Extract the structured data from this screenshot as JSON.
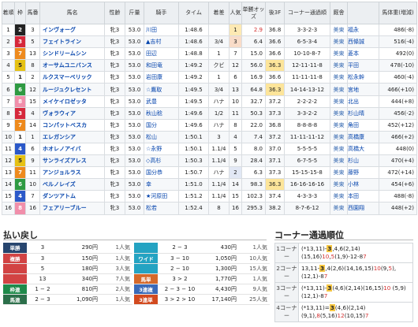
{
  "headers": {
    "rank": "着順",
    "waku": "枠",
    "num": "馬番",
    "name": "馬名",
    "sex_age": "性齢",
    "weight": "斤量",
    "jockey": "騎手",
    "time": "タイム",
    "margin": "着差",
    "pop": "人気",
    "odds": "単勝オッズ",
    "last3f": "後3F",
    "corner": "コーナー通過順",
    "aff": "厩舎",
    "body": "馬体重(増減)"
  },
  "horses": [
    {
      "rank": "1",
      "waku": "2",
      "num": "3",
      "name": "インヴォーグ",
      "sex_age": "牝3",
      "weight": "53.0",
      "jockey": "川田",
      "time": "1:48.6",
      "margin": "",
      "pop": "1",
      "odds": "2.9",
      "last3f": "36.8",
      "corner": "3-3-2-3",
      "aff": "美東",
      "trainer": "福永",
      "body": "486(-8)"
    },
    {
      "rank": "2",
      "waku": "3",
      "num": "5",
      "name": "フェイトライン",
      "sex_age": "牝3",
      "weight": "53.0",
      "jockey": "▲吉村",
      "time": "1:48.6",
      "margin": "3/4",
      "pop": "3",
      "odds": "6.4",
      "last3f": "36.6",
      "corner": "6-5-3-4",
      "aff": "美東",
      "trainer": "西條誠",
      "body": "516(-4)"
    },
    {
      "rank": "3",
      "waku": "7",
      "num": "13",
      "name": "シンドリームシン",
      "sex_age": "牝3",
      "weight": "53.0",
      "jockey": "田辺",
      "time": "1:48.8",
      "margin": "1",
      "pop": "7",
      "odds": "15.0",
      "last3f": "36.6",
      "corner": "10-10-8-7",
      "aff": "美東",
      "trainer": "菱本",
      "body": "492(0)"
    },
    {
      "rank": "4",
      "waku": "5",
      "num": "8",
      "name": "オーサムユニバンス",
      "sex_age": "牝3",
      "weight": "53.0",
      "jockey": "和田竜",
      "time": "1:49.2",
      "margin": "クビ",
      "pop": "12",
      "odds": "56.0",
      "last3f": "36.3",
      "corner": "12-11-11-8",
      "aff": "美東",
      "trainer": "平田",
      "body": "478(-10)"
    },
    {
      "rank": "5",
      "waku": "1",
      "num": "2",
      "name": "ルクスマーベリック",
      "sex_age": "牝3",
      "weight": "53.0",
      "jockey": "岩田康",
      "time": "1:49.2",
      "margin": "1",
      "pop": "6",
      "odds": "16.9",
      "last3f": "36.6",
      "corner": "11-11-11-8",
      "aff": "美東",
      "trainer": "松永幹",
      "body": "460(-4)"
    },
    {
      "rank": "6",
      "waku": "6",
      "num": "12",
      "name": "ルージュクレセント",
      "sex_age": "牝3",
      "weight": "53.0",
      "jockey": "☆鷹取",
      "time": "1:49.5",
      "margin": "3/4",
      "pop": "13",
      "odds": "64.8",
      "last3f": "36.3",
      "corner": "14-14-13-12",
      "aff": "美東",
      "trainer": "宮地",
      "body": "466(+10)"
    },
    {
      "rank": "7",
      "waku": "8",
      "num": "15",
      "name": "メイケイロゼッタ",
      "sex_age": "牝3",
      "weight": "53.0",
      "jockey": "武豊",
      "time": "1:49.5",
      "margin": "ハナ",
      "pop": "10",
      "odds": "32.7",
      "last3f": "37.2",
      "corner": "2-2-2-2",
      "aff": "美東",
      "trainer": "北出",
      "body": "444(+8)"
    },
    {
      "rank": "8",
      "waku": "3",
      "num": "4",
      "name": "ヴォラウィア",
      "sex_age": "牝3",
      "weight": "53.0",
      "jockey": "秋山稔",
      "time": "1:49.6",
      "margin": "1/2",
      "pop": "11",
      "odds": "50.3",
      "last3f": "37.3",
      "corner": "3-3-2-2",
      "aff": "美東",
      "trainer": "杉山晴",
      "body": "456(-2)"
    },
    {
      "rank": "9",
      "waku": "7",
      "num": "14",
      "name": "コンパットベスカ",
      "sex_age": "牝3",
      "weight": "53.0",
      "jockey": "国分",
      "time": "1:49.6",
      "margin": "ハナ",
      "pop": "8",
      "odds": "22.0",
      "last3f": "36.8",
      "corner": "8-8-8-8",
      "aff": "美東",
      "trainer": "角田",
      "body": "452(+12)"
    },
    {
      "rank": "10",
      "waku": "1",
      "num": "1",
      "name": "エレガンシア",
      "sex_age": "牝3",
      "weight": "53.0",
      "jockey": "松山",
      "time": "1:50.1",
      "margin": "3",
      "pop": "4",
      "odds": "7.4",
      "last3f": "37.2",
      "corner": "11-11-11-12",
      "aff": "美東",
      "trainer": "高橋康",
      "body": "466(+2)"
    },
    {
      "rank": "11",
      "waku": "4",
      "num": "6",
      "name": "ホオレノアイバ",
      "sex_age": "牝3",
      "weight": "53.0",
      "jockey": "☆永野",
      "time": "1:50.1",
      "margin": "1.1/4",
      "pop": "5",
      "odds": "8.0",
      "last3f": "37.0",
      "corner": "5-5-5-5",
      "aff": "美東",
      "trainer": "高橋大",
      "body": "448(0)"
    },
    {
      "rank": "12",
      "waku": "5",
      "num": "9",
      "name": "サンライズアレス",
      "sex_age": "牝3",
      "weight": "53.0",
      "jockey": "◇高杉",
      "time": "1:50.3",
      "margin": "1.1/4",
      "pop": "9",
      "odds": "28.4",
      "last3f": "37.1",
      "corner": "6-7-5-5",
      "aff": "美東",
      "trainer": "杉山",
      "body": "470(+4)"
    },
    {
      "rank": "13",
      "waku": "7",
      "num": "11",
      "name": "アンジョルラス",
      "sex_age": "牝3",
      "weight": "53.0",
      "jockey": "国分恭",
      "time": "1:50.7",
      "margin": "ハナ",
      "pop": "2",
      "odds": "6.3",
      "last3f": "37.3",
      "corner": "15-15-15-8",
      "aff": "美東",
      "trainer": "藤野",
      "body": "472(+14)"
    },
    {
      "rank": "14",
      "waku": "6",
      "num": "10",
      "name": "ベルノレイズ",
      "sex_age": "牝3",
      "weight": "53.0",
      "jockey": "幸",
      "time": "1:51.0",
      "margin": "1.1/4",
      "pop": "14",
      "odds": "98.3",
      "last3f": "36.3",
      "corner": "16-16-16-16",
      "aff": "美東",
      "trainer": "小林",
      "body": "454(+6)"
    },
    {
      "rank": "15",
      "waku": "4",
      "num": "7",
      "name": "ダンツアトム",
      "sex_age": "牝3",
      "weight": "53.0",
      "jockey": "★河原田",
      "time": "1:51.2",
      "margin": "1.1/4",
      "pop": "15",
      "odds": "102.3",
      "last3f": "37.4",
      "corner": "4-3-3-3",
      "aff": "美東",
      "trainer": "本田",
      "body": "488(-8)"
    },
    {
      "rank": "16",
      "waku": "8",
      "num": "16",
      "name": "フェアリーブルー",
      "sex_age": "牝3",
      "weight": "53.0",
      "jockey": "松若",
      "time": "1:52.4",
      "margin": "8",
      "pop": "16",
      "odds": "295.3",
      "last3f": "38.2",
      "corner": "8-7-6-12",
      "aff": "美東",
      "trainer": "西園翔",
      "body": "448(+2)"
    }
  ],
  "payout": {
    "title": "払い戻し",
    "left": [
      {
        "type": "単勝",
        "num": "3",
        "amt": "290円",
        "pop": "1人気",
        "cls": "bt-tan"
      },
      {
        "type": "複勝",
        "num": "3",
        "amt": "150円",
        "pop": "1人気",
        "cls": "bt-fuku"
      },
      {
        "type": "",
        "num": "5",
        "amt": "180円",
        "pop": "3人気",
        "cls": "bt-fuku"
      },
      {
        "type": "",
        "num": "13",
        "amt": "340円",
        "pop": "7人気",
        "cls": "bt-fuku"
      },
      {
        "type": "枠連",
        "num": "1 − 2",
        "amt": "810円",
        "pop": "2人気",
        "cls": "bt-waku"
      },
      {
        "type": "馬連",
        "num": "2 − 3",
        "amt": "1,090円",
        "pop": "1人気",
        "cls": "bt-uren"
      }
    ],
    "right": [
      {
        "type": "",
        "num": "2 − 3",
        "amt": "430円",
        "pop": "1人気",
        "cls": "bt-wide"
      },
      {
        "type": "ワイド",
        "num": "3 − 10",
        "amt": "1,050円",
        "pop": "10人気",
        "cls": "bt-wide"
      },
      {
        "type": "",
        "num": "2 − 10",
        "amt": "1,300円",
        "pop": "15人気",
        "cls": "bt-wide"
      },
      {
        "type": "馬単",
        "num": "3 > 2",
        "amt": "1,770円",
        "pop": "1人気",
        "cls": "bt-uta"
      },
      {
        "type": "3連複",
        "num": "2 − 3 − 10",
        "amt": "4,430円",
        "pop": "9人気",
        "cls": "bt-3fuku"
      },
      {
        "type": "3連単",
        "num": "3 > 2 > 10",
        "amt": "17,140円",
        "pop": "25人気",
        "cls": "bt-3tan"
      }
    ]
  },
  "corner": {
    "title": "コーナー通過順位",
    "rows": [
      {
        "label": "1コーナー",
        "parts": [
          [
            "(*13,11)-",
            ""
          ],
          [
            "3",
            "hl"
          ],
          [
            ",4,6(2,14)(15,16)",
            ""
          ],
          [
            "10",
            "red"
          ],
          [
            ",",
            ""
          ],
          [
            "5",
            "red"
          ],
          [
            "(1,9)-12-8",
            ""
          ],
          [
            "7",
            "red"
          ]
        ]
      },
      {
        "label": "2コーナー",
        "parts": [
          [
            "13,11-",
            ""
          ],
          [
            "3",
            "hl"
          ],
          [
            ",4(2,6)(14,16,15)",
            ""
          ],
          [
            "10",
            "red"
          ],
          [
            "(9,",
            ""
          ],
          [
            "5",
            "red"
          ],
          [
            "),(12,1)-8",
            ""
          ],
          [
            "7",
            "red"
          ]
        ]
      },
      {
        "label": "3コーナー",
        "parts": [
          [
            "(*13,11)-",
            ""
          ],
          [
            "3",
            "hl"
          ],
          [
            "(4,6)(2,14)(16,15)",
            ""
          ],
          [
            "10",
            "red"
          ],
          [
            " (5,9)(12,1)-8",
            ""
          ],
          [
            "7",
            "red"
          ]
        ]
      },
      {
        "label": "4コーナー",
        "parts": [
          [
            "(*13,11)=",
            ""
          ],
          [
            "3",
            "hl"
          ],
          [
            "(4,6)(2,14)(9,1),",
            ""
          ],
          [
            "8",
            "red"
          ],
          [
            "(5,16)",
            ""
          ],
          [
            "12",
            "red"
          ],
          [
            "(10,15)",
            ""
          ],
          [
            "7",
            "red"
          ]
        ]
      }
    ]
  }
}
